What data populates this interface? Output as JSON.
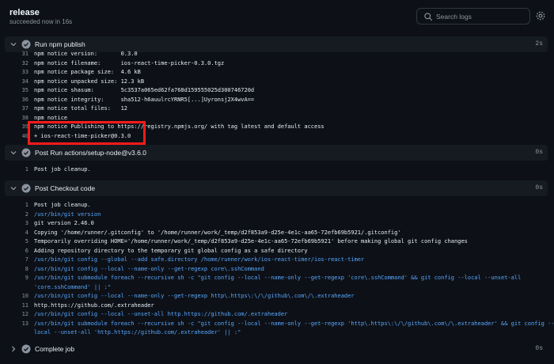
{
  "header": {
    "title": "release",
    "subtitle": "succeeded now in 16s",
    "search_placeholder": "Search logs"
  },
  "steps": {
    "npm_publish": {
      "label": "Run npm publish",
      "duration": "2s"
    },
    "post_setup_node": {
      "label": "Post Run actions/setup-node@v3.6.0",
      "duration": "0s"
    },
    "post_checkout": {
      "label": "Post Checkout code",
      "duration": "0s"
    },
    "complete": {
      "label": "Complete job",
      "duration": "0s"
    }
  },
  "publish_lines": [
    {
      "n": "31",
      "t": "npm notice version:       0.3.0"
    },
    {
      "n": "32",
      "t": "npm notice filename:      ios-react-time-picker-0.3.0.tgz"
    },
    {
      "n": "33",
      "t": "npm notice package size:  4.6 kB"
    },
    {
      "n": "34",
      "t": "npm notice unpacked size: 12.3 kB"
    },
    {
      "n": "35",
      "t": "npm notice shasum:        5c3537a065ed62fa768d159555025d300746720d"
    },
    {
      "n": "36",
      "t": "npm notice integrity:     sha512-h6auulrcYRNR5[...]Uyronsj2X4wvA=="
    },
    {
      "n": "37",
      "t": "npm notice total files:   12"
    },
    {
      "n": "38",
      "t": "npm notice"
    },
    {
      "n": "39",
      "t": "npm notice Publishing to https://registry.npmjs.org/ with tag latest and default access"
    },
    {
      "n": "40",
      "t": "+ ios-react-time-picker@0.3.0"
    }
  ],
  "setup_node_lines": [
    {
      "n": "1",
      "t": "Post job cleanup."
    }
  ],
  "checkout_lines": [
    {
      "n": "1",
      "t": "Post job cleanup.",
      "c": "w"
    },
    {
      "n": "2",
      "t": "/usr/bin/git version",
      "c": "b"
    },
    {
      "n": "3",
      "t": "git version 2.46.0",
      "c": "w"
    },
    {
      "n": "4",
      "t": "Copying '/home/runner/.gitconfig' to '/home/runner/work/_temp/d2f853a9-d25e-4e1c-aa65-72efb69b5921/.gitconfig'",
      "c": "w"
    },
    {
      "n": "5",
      "t": "Temporarily overriding HOME='/home/runner/work/_temp/d2f853a9-d25e-4e1c-aa65-72efb69b5921' before making global git config changes",
      "c": "w"
    },
    {
      "n": "6",
      "t": "Adding repository directory to the temporary git global config as a safe directory",
      "c": "w"
    },
    {
      "n": "7",
      "t": "/usr/bin/git config --global --add safe.directory /home/runner/work/ios-react-timer/ios-react-timer",
      "c": "b"
    },
    {
      "n": "8",
      "t": "/usr/bin/git config --local --name-only --get-regexp core\\.sshCommand",
      "c": "b"
    },
    {
      "n": "9",
      "t": "/usr/bin/git submodule foreach --recursive sh -c \"git config --local --name-only --get-regexp 'core\\.sshCommand' && git config --local --unset-all",
      "c": "b"
    },
    {
      "n": "",
      "t": "'core.sshCommand' || :\"",
      "c": "b"
    },
    {
      "n": "10",
      "t": "/usr/bin/git config --local --name-only --get-regexp http\\.https\\:\\/\\/github\\.com\\/\\.extraheader",
      "c": "b"
    },
    {
      "n": "11",
      "t": "http.https://github.com/.extraheader",
      "c": "w"
    },
    {
      "n": "12",
      "t": "/usr/bin/git config --local --unset-all http.https://github.com/.extraheader",
      "c": "b"
    },
    {
      "n": "13",
      "t": "/usr/bin/git submodule foreach --recursive sh -c \"git config --local --name-only --get-regexp 'http\\.https\\:\\/\\/github\\.com\\/\\.extraheader' && git config --",
      "c": "b"
    },
    {
      "n": "",
      "t": "local --unset-all 'http.https://github.com/.extraheader' || :\"",
      "c": "b"
    }
  ]
}
